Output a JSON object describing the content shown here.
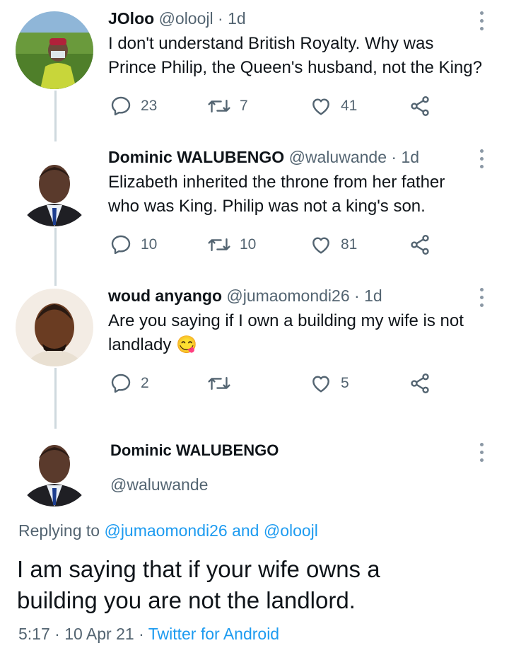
{
  "tweets": [
    {
      "name": "JOloo",
      "handle": "@oloojl",
      "time": "1d",
      "lines": [
        "I don't understand British Royalty. Why was",
        "Prince Philip, the Queen's husband, not the King?"
      ],
      "replies": "23",
      "retweets": "7",
      "likes": "41"
    },
    {
      "name": "Dominic WALUBENGO",
      "handle": "@waluwande",
      "time": "1d",
      "lines": [
        "Elizabeth inherited the throne from her father",
        "who was King. Philip was not a king's son."
      ],
      "replies": "10",
      "retweets": "10",
      "likes": "81"
    },
    {
      "name": "woud anyango",
      "handle": "@jumaomondi26",
      "time": "1d",
      "lines": [
        "Are you saying if I own a building my wife is not",
        "landlady"
      ],
      "emoji": "😋",
      "replies": "2",
      "retweets": "",
      "likes": "5"
    }
  ],
  "main": {
    "name": "Dominic WALUBENGO",
    "handle": "@waluwande",
    "replying_prefix": "Replying to",
    "replying_user1": "@jumaomondi26",
    "replying_and": "and",
    "replying_user2": "@oloojl",
    "text_line1": "I am saying that if your wife owns a",
    "text_line2": "building you are not the landlord.",
    "time": "5:17",
    "date": "10 Apr 21",
    "source": "Twitter for Android"
  },
  "separator": "·",
  "colors": {
    "link": "#1d9bf0",
    "muted": "#536471",
    "thread_line": "#cfd9de"
  }
}
